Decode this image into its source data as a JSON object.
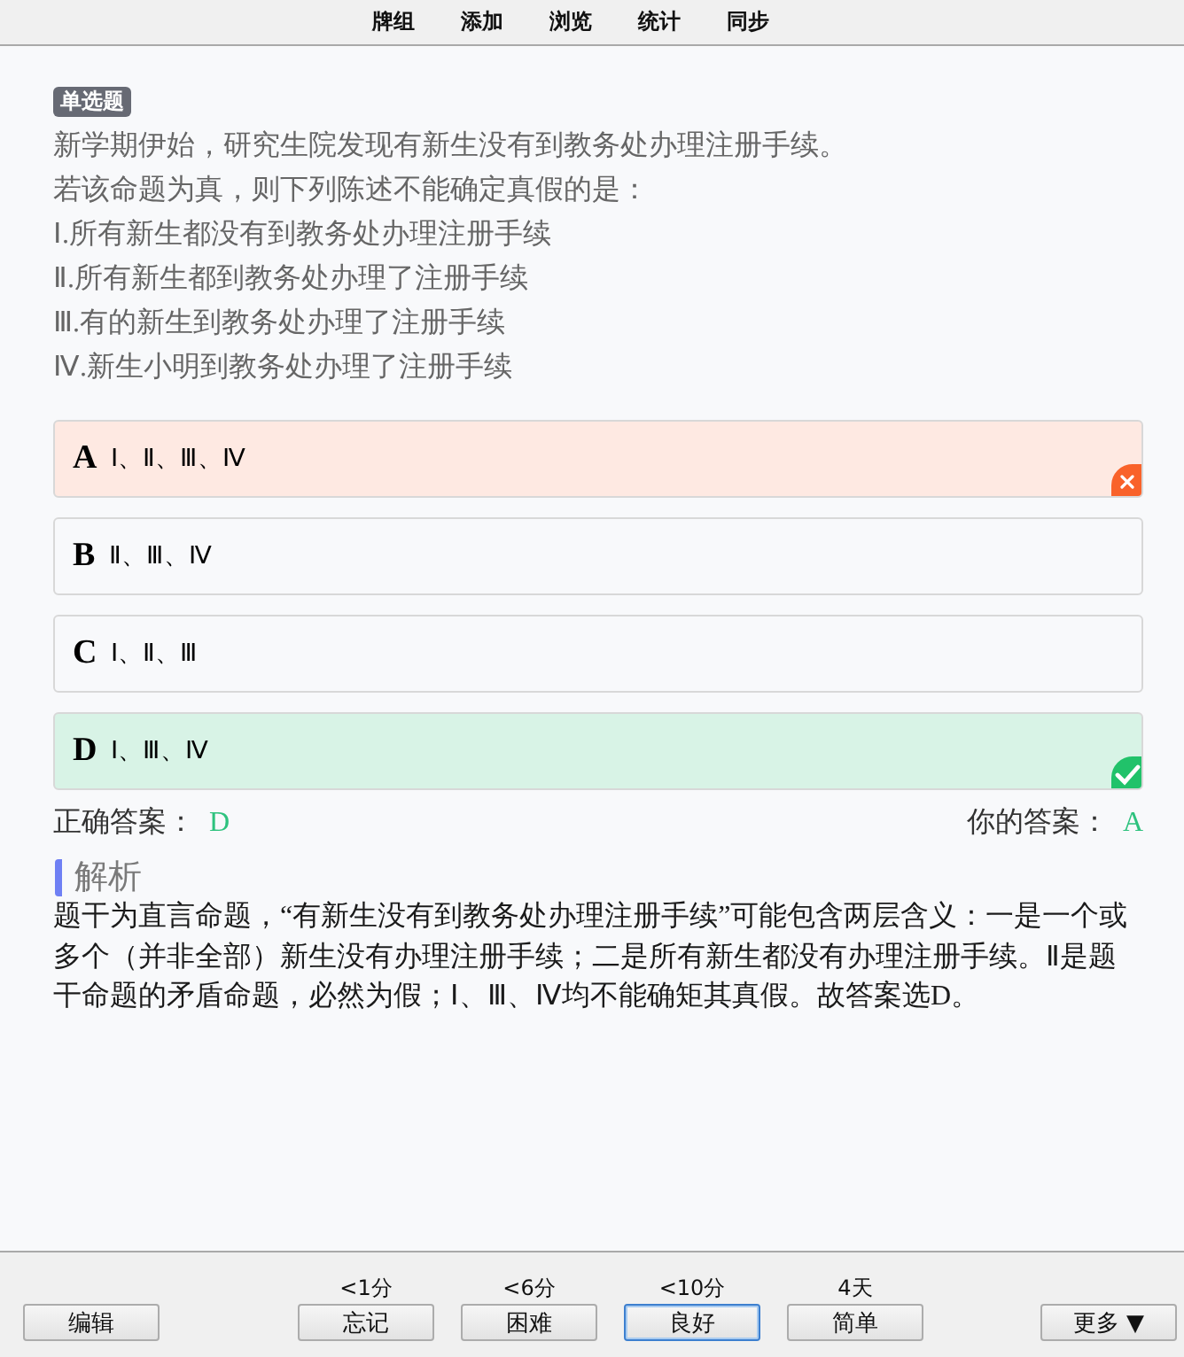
{
  "menu_bar": {
    "items": [
      "牌组",
      "添加",
      "浏览",
      "统计",
      "同步"
    ]
  },
  "question": {
    "type_badge": "单选题",
    "lines": [
      "新学期伊始，研究生院发现有新生没有到教务处办理注册手续。",
      "若该命题为真，则下列陈述不能确定真假的是：",
      "Ⅰ.所有新生都没有到教务处办理注册手续",
      "Ⅱ.所有新生都到教务处办理了注册手续",
      "Ⅲ.有的新生到教务处办理了注册手续",
      "Ⅳ.新生小明到教务处办理了注册手续"
    ]
  },
  "options": [
    {
      "letter": "A",
      "text": "Ⅰ、Ⅱ、Ⅲ、Ⅳ",
      "chosen": true,
      "correct": false
    },
    {
      "letter": "B",
      "text": "Ⅱ、Ⅲ、Ⅳ",
      "chosen": false,
      "correct": false
    },
    {
      "letter": "C",
      "text": "Ⅰ、Ⅱ、Ⅲ",
      "chosen": false,
      "correct": false
    },
    {
      "letter": "D",
      "text": "Ⅰ、Ⅲ、Ⅳ",
      "chosen": false,
      "correct": true
    }
  ],
  "answer_summary": {
    "correct_label": "正确答案：",
    "correct_value": "D",
    "yours_label": "你的答案：",
    "yours_value": "A"
  },
  "explanation": {
    "heading": "解析",
    "text": "题干为直言命题，“有新生没有到教务处办理注册手续”可能包含两层含义：一是一个或多个（并非全部）新生没有办理注册手续；二是所有新生都没有办理注册手续。Ⅱ是题干命题的矛盾命题，必然为假；Ⅰ、Ⅲ、Ⅳ均不能确矩其真假。故答案选D。"
  },
  "bottom_bar": {
    "edit_button": "编辑",
    "answer_buttons": [
      {
        "interval": "<1分",
        "label": "忘记",
        "focused": false
      },
      {
        "interval": "<6分",
        "label": "困难",
        "focused": false
      },
      {
        "interval": "<10分",
        "label": "良好",
        "focused": true
      },
      {
        "interval": "4天",
        "label": "简单",
        "focused": false
      }
    ],
    "more_button": "更多 ▼"
  }
}
